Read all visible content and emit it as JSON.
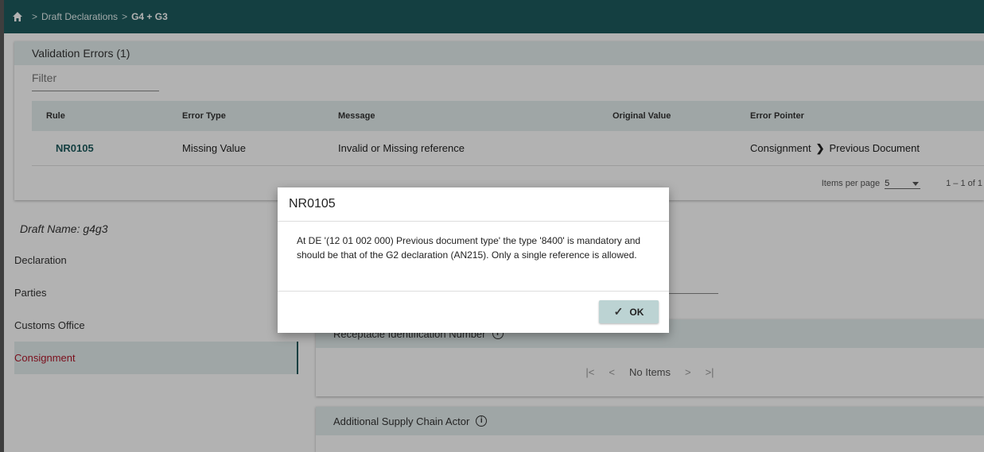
{
  "breadcrumb": {
    "items": [
      "Draft Declarations"
    ],
    "current": "G4 + G3",
    "separator": ">"
  },
  "validation": {
    "title": "Validation Errors (1)",
    "filter_placeholder": "Filter",
    "columns": [
      "Rule",
      "Error Type",
      "Message",
      "Original Value",
      "Error Pointer"
    ],
    "rows": [
      {
        "rule": "NR0105",
        "error_type": "Missing Value",
        "message": "Invalid or Missing reference",
        "original_value": "",
        "pointer_from": "Consignment",
        "pointer_to": "Previous Document"
      }
    ],
    "items_per_page_label": "Items per page",
    "items_per_page": "5",
    "range": "1 – 1 of 1"
  },
  "draft": {
    "name_label": "Draft Name: g4g3"
  },
  "side_nav": {
    "items": [
      "Declaration",
      "Parties",
      "Customs Office",
      "Consignment"
    ],
    "active": "Consignment"
  },
  "receptacle": {
    "title": "Receptacle Identification Number",
    "pager_text": "No Items"
  },
  "supply_chain": {
    "title": "Additional Supply Chain Actor"
  },
  "dialog": {
    "title": "NR0105",
    "message": "At DE '(12 01 002 000) Previous document type' the type '8400' is mandatory and should be that of the G2 declaration (AN215). Only a single reference is allowed.",
    "ok_label": "OK"
  },
  "colors": {
    "topbar": "#1d5b5d",
    "panel_header": "#e4eeee",
    "active_nav_text": "#b0172a",
    "ok_button": "#bcd3d3"
  }
}
